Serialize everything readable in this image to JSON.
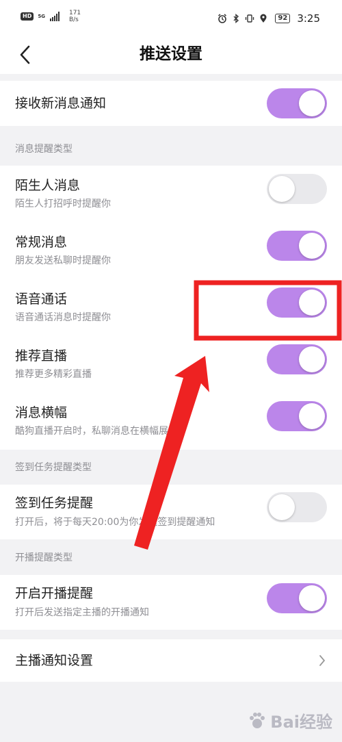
{
  "status_bar": {
    "hd": "HD",
    "signal_gen": "5G",
    "net_speed_value": "171",
    "net_speed_unit": "B/s",
    "battery": "92",
    "time": "3:25"
  },
  "nav": {
    "title": "推送设置"
  },
  "main_toggle": {
    "label": "接收新消息通知",
    "on": true
  },
  "sections": {
    "message_type": "消息提醒类型",
    "checkin_type": "签到任务提醒类型",
    "live_type": "开播提醒类型"
  },
  "items": [
    {
      "title": "陌生人消息",
      "subtitle": "陌生人打招呼时提醒你",
      "on": false
    },
    {
      "title": "常规消息",
      "subtitle": "朋友发送私聊时提醒你",
      "on": true
    },
    {
      "title": "语音通话",
      "subtitle": "语音通话消息时提醒你",
      "on": true
    },
    {
      "title": "推荐直播",
      "subtitle": "推荐更多精彩直播",
      "on": true
    },
    {
      "title": "消息横幅",
      "subtitle": "酷狗直播开启时，私聊消息在横幅展示",
      "on": true
    }
  ],
  "checkin": {
    "title": "签到任务提醒",
    "subtitle": "打开后，将于每天20:00为你发送签到提醒通知",
    "on": false
  },
  "live": {
    "title": "开启开播提醒",
    "subtitle": "打开后发送指定主播的开播通知",
    "on": true
  },
  "anchor_settings": {
    "label": "主播通知设置"
  },
  "watermark": {
    "text": "Bai经验"
  },
  "colors": {
    "toggle_on": "#bb86ea",
    "toggle_off": "#e9e9ec",
    "annotation": "#ee2222"
  },
  "icons": {
    "back": "chevron-left-icon",
    "chevron": "chevron-right-icon",
    "alarm": "alarm-icon",
    "bluetooth": "bluetooth-icon",
    "vibrate": "vibrate-icon",
    "location": "location-icon",
    "signal": "signal-icon"
  }
}
